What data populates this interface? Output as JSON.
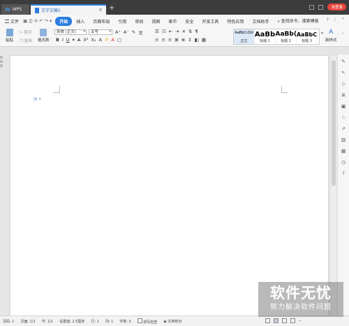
{
  "titlebar": {
    "wps_tab": "WPS",
    "doc_tab": "文字文稿1",
    "new_tab": "+",
    "user_label": "未登录"
  },
  "menu": {
    "file": "文件",
    "tabs": [
      "开始",
      "插入",
      "页面布局",
      "引用",
      "审阅",
      "视图",
      "章节",
      "安全",
      "开发工具",
      "特色应用",
      "文档助手"
    ],
    "active_tab": "开始",
    "search": "查找命令、搜索模板",
    "help": "?"
  },
  "ribbon": {
    "paste": "粘贴",
    "cut": "剪切",
    "copy": "复制",
    "format_painter": "格式刷",
    "font_name": "宋体 (正文)",
    "font_size": "五号",
    "new_style": "新样式",
    "styles": [
      {
        "sample": "AaBbCcDd",
        "name": "正文"
      },
      {
        "sample": "AaBb",
        "name": "标题 1"
      },
      {
        "sample": "AaBb(",
        "name": "标题 2"
      },
      {
        "sample": "AaBbC",
        "name": "标题 3"
      }
    ]
  },
  "status": {
    "page_num": "页码: 1",
    "pages": "页面: 1/1",
    "section": "节: 1/1",
    "setting": "设置值: 2.5厘米",
    "row": "行: 1",
    "col": "列: 1",
    "words": "字数: 0",
    "spell": "拼写检查",
    "proof": "文档校对"
  },
  "watermark": {
    "main": "软件无忧",
    "sub": "努力解决软件问题"
  }
}
